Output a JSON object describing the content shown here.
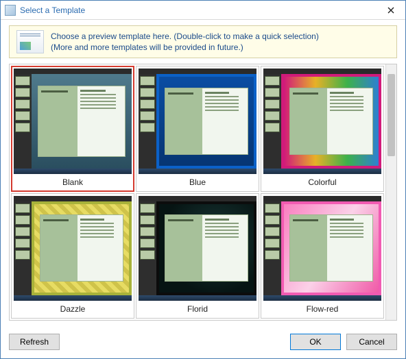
{
  "window": {
    "title": "Select a Template"
  },
  "info": {
    "line1": "Choose a preview template here. (Double-click to make a quick selection)",
    "line2": "(More and more templates will be provided in future.)"
  },
  "templates": [
    {
      "label": "Blank",
      "bg_class": "bg-blank",
      "selected": true
    },
    {
      "label": "Blue",
      "bg_class": "bg-blue",
      "selected": false
    },
    {
      "label": "Colorful",
      "bg_class": "bg-colorful",
      "selected": false
    },
    {
      "label": "Dazzle",
      "bg_class": "bg-dazzle",
      "selected": false
    },
    {
      "label": "Florid",
      "bg_class": "bg-florid",
      "selected": false
    },
    {
      "label": "Flow-red",
      "bg_class": "bg-flowred",
      "selected": false
    }
  ],
  "buttons": {
    "refresh": "Refresh",
    "ok": "OK",
    "cancel": "Cancel"
  }
}
